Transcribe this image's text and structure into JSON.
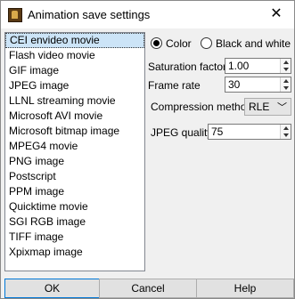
{
  "window": {
    "title": "Animation save settings",
    "close_glyph": "✕"
  },
  "formats": [
    "CEI envideo movie",
    "Flash video movie",
    "GIF image",
    "JPEG image",
    "LLNL streaming movie",
    "Microsoft AVI movie",
    "Microsoft bitmap image",
    "MPEG4 movie",
    "PNG image",
    "Postscript",
    "PPM image",
    "Quicktime movie",
    "SGI RGB image",
    "TIFF image",
    "Xpixmap image"
  ],
  "selected_format": "CEI envideo movie",
  "color_mode": {
    "color_label": "Color",
    "bw_label": "Black and white",
    "selected": "Color"
  },
  "saturation": {
    "label": "Saturation factor",
    "value": "1.00"
  },
  "frame_rate": {
    "label": "Frame rate",
    "value": "30"
  },
  "compression": {
    "label": "Compression method",
    "value": "RLE"
  },
  "jpeg_quality": {
    "label": "JPEG quality",
    "value": "75"
  },
  "buttons": {
    "ok": "OK",
    "cancel": "Cancel",
    "help": "Help"
  }
}
